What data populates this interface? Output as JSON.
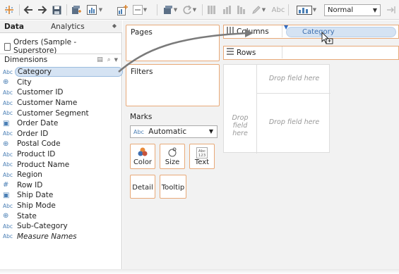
{
  "toolbar": {
    "zoom_select": "Normal",
    "text_label": "Abc"
  },
  "left_pane": {
    "tab_data": "Data",
    "tab_analytics": "Analytics",
    "datasource": "Orders (Sample - Superstore)",
    "dimensions_header": "Dimensions",
    "fields": [
      {
        "icon": "Abc",
        "name": "Category",
        "selected": true
      },
      {
        "icon": "geo",
        "name": "City"
      },
      {
        "icon": "Abc",
        "name": "Customer ID"
      },
      {
        "icon": "Abc",
        "name": "Customer Name"
      },
      {
        "icon": "Abc",
        "name": "Customer Segment"
      },
      {
        "icon": "date",
        "name": "Order Date"
      },
      {
        "icon": "Abc",
        "name": "Order ID"
      },
      {
        "icon": "geo",
        "name": "Postal Code"
      },
      {
        "icon": "Abc",
        "name": "Product ID"
      },
      {
        "icon": "Abc",
        "name": "Product Name"
      },
      {
        "icon": "Abc",
        "name": "Region"
      },
      {
        "icon": "#",
        "name": "Row ID"
      },
      {
        "icon": "date",
        "name": "Ship Date"
      },
      {
        "icon": "Abc",
        "name": "Ship Mode"
      },
      {
        "icon": "geo",
        "name": "State"
      },
      {
        "icon": "Abc",
        "name": "Sub-Category"
      },
      {
        "icon": "Abc",
        "name": "Measure Names",
        "italic": true
      }
    ]
  },
  "cards": {
    "pages": "Pages",
    "filters": "Filters",
    "marks": "Marks",
    "mark_type": "Automatic",
    "mark_type_icon": "Abc",
    "buttons": {
      "color": "Color",
      "size": "Size",
      "text": "Text",
      "detail": "Detail",
      "tooltip": "Tooltip"
    }
  },
  "shelves": {
    "columns": "Columns",
    "rows": "Rows",
    "dragged_pill": "Category"
  },
  "view": {
    "drop_top": "Drop field here",
    "drop_left": "Drop field here",
    "drop_center": "Drop field here"
  },
  "colors": {
    "accent_orange": "#e8a978",
    "pill_blue": "#d5e3f3",
    "icon_blue": "#4a7fb5"
  }
}
